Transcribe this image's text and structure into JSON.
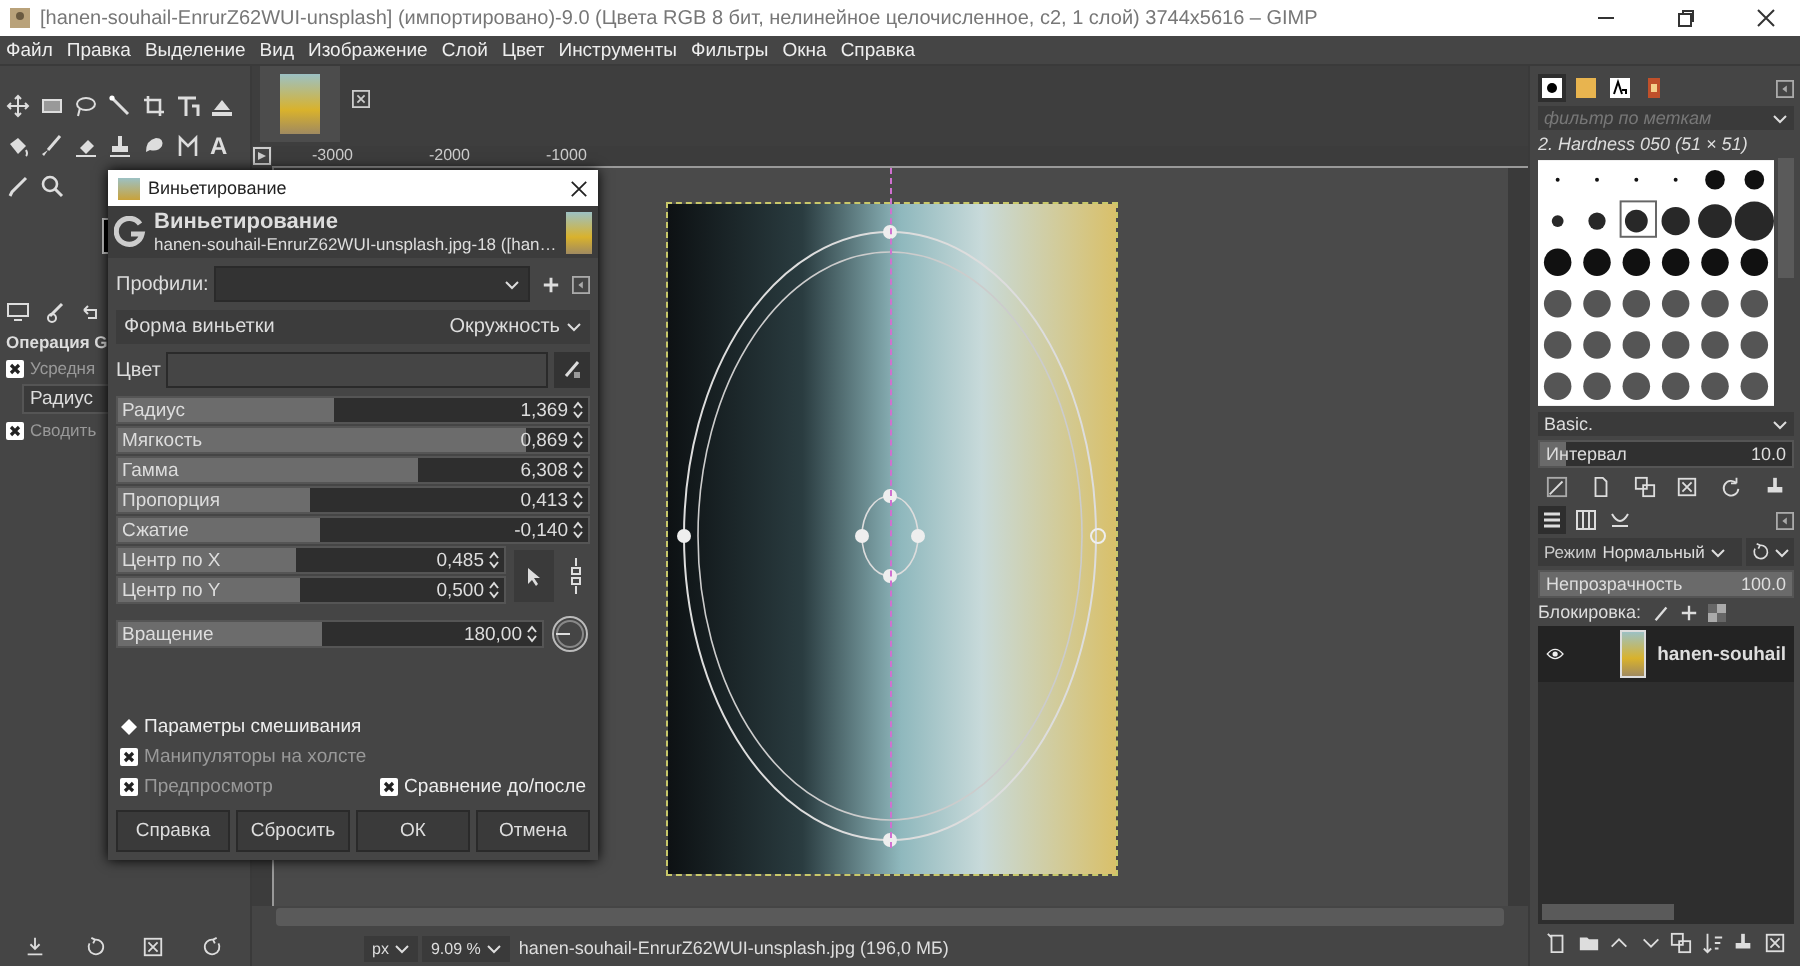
{
  "window": {
    "title": "[hanen-souhail-EnrurZ62WUI-unsplash] (импортировано)-9.0 (Цвета RGB 8 бит, нелинейное целочисленное, c2, 1 слой) 3744x5616 – GIMP"
  },
  "menu": [
    "Файл",
    "Правка",
    "Выделение",
    "Вид",
    "Изображение",
    "Слой",
    "Цвет",
    "Инструменты",
    "Фильтры",
    "Окна",
    "Справка"
  ],
  "toolbox": {
    "text_tool_glyph": "A"
  },
  "tool_options": {
    "title": "Операция G",
    "options": [
      {
        "kind": "checkbox",
        "label": "Усредня",
        "checked": true
      },
      {
        "kind": "field",
        "value": "Радиус"
      },
      {
        "kind": "checkbox",
        "label": "Сводить",
        "checked": true
      }
    ]
  },
  "canvas": {
    "ruler_labels": [
      "-3000",
      "-2000",
      "-1000"
    ]
  },
  "dialog": {
    "window_title": "Виньетирование",
    "heading": "Виньетирование",
    "subtitle": "hanen-souhail-EnrurZ62WUI-unsplash.jpg-18 ([han…",
    "profiles_label": "Профили:",
    "shape": {
      "label": "Форма виньетки",
      "value": "Окружность"
    },
    "color": {
      "label": "Цвет"
    },
    "sliders": [
      {
        "kind": "plain",
        "label": "Радиус",
        "value": "1,369",
        "level": 0.46
      },
      {
        "kind": "plain",
        "label": "Мягкость",
        "value": "0,869",
        "level": 0.87
      },
      {
        "kind": "plain",
        "label": "Гамма",
        "value": "6,308",
        "level": 0.64
      },
      {
        "kind": "plain",
        "label": "Пропорция",
        "value": "0,413",
        "level": 0.41
      },
      {
        "kind": "plain",
        "label": "Сжатие",
        "value": "-0,140",
        "level": 0.43
      },
      {
        "kind": "center",
        "label": "Центр по X",
        "value": "0,485",
        "level": 0.46
      },
      {
        "kind": "center",
        "label": "Центр по Y",
        "value": "0,500",
        "level": 0.47
      },
      {
        "kind": "angle",
        "label": "Вращение",
        "value": "180,00",
        "level": 0.48
      }
    ],
    "options": [
      {
        "kind": "expander",
        "label": "Параметры смешивания",
        "expanded": false,
        "disabled": false
      },
      {
        "kind": "checkbox",
        "label": "Манипуляторы на холсте",
        "checked": true,
        "disabled": true
      }
    ],
    "option_pair": [
      {
        "label": "Предпросмотр",
        "checked": true,
        "disabled": true
      },
      {
        "label": "Сравнение до/после",
        "checked": true,
        "disabled": false
      }
    ],
    "buttons": [
      "Справка",
      "Сбросить",
      "ОК",
      "Отмена"
    ]
  },
  "status_bar": {
    "unit": "px",
    "zoom": "9.09 %",
    "file": "hanen-souhail-EnrurZ62WUI-unsplash.jpg (196,0 МБ)"
  },
  "brushes": {
    "filter_placeholder": "фильтр по меткам",
    "brush_name": "2. Hardness 050 (51 × 51)",
    "tag": "Basic.",
    "spacing": {
      "label": "Интервал",
      "value": "10.0",
      "level": 0.1
    }
  },
  "layers": {
    "mode_label": "Режим",
    "mode": "Нормальный",
    "opacity": {
      "label": "Непрозрачность",
      "value": "100.0",
      "level": 1
    },
    "lock_label": "Блокировка:",
    "items": [
      {
        "name": "hanen-souhail",
        "visible": true
      }
    ]
  }
}
